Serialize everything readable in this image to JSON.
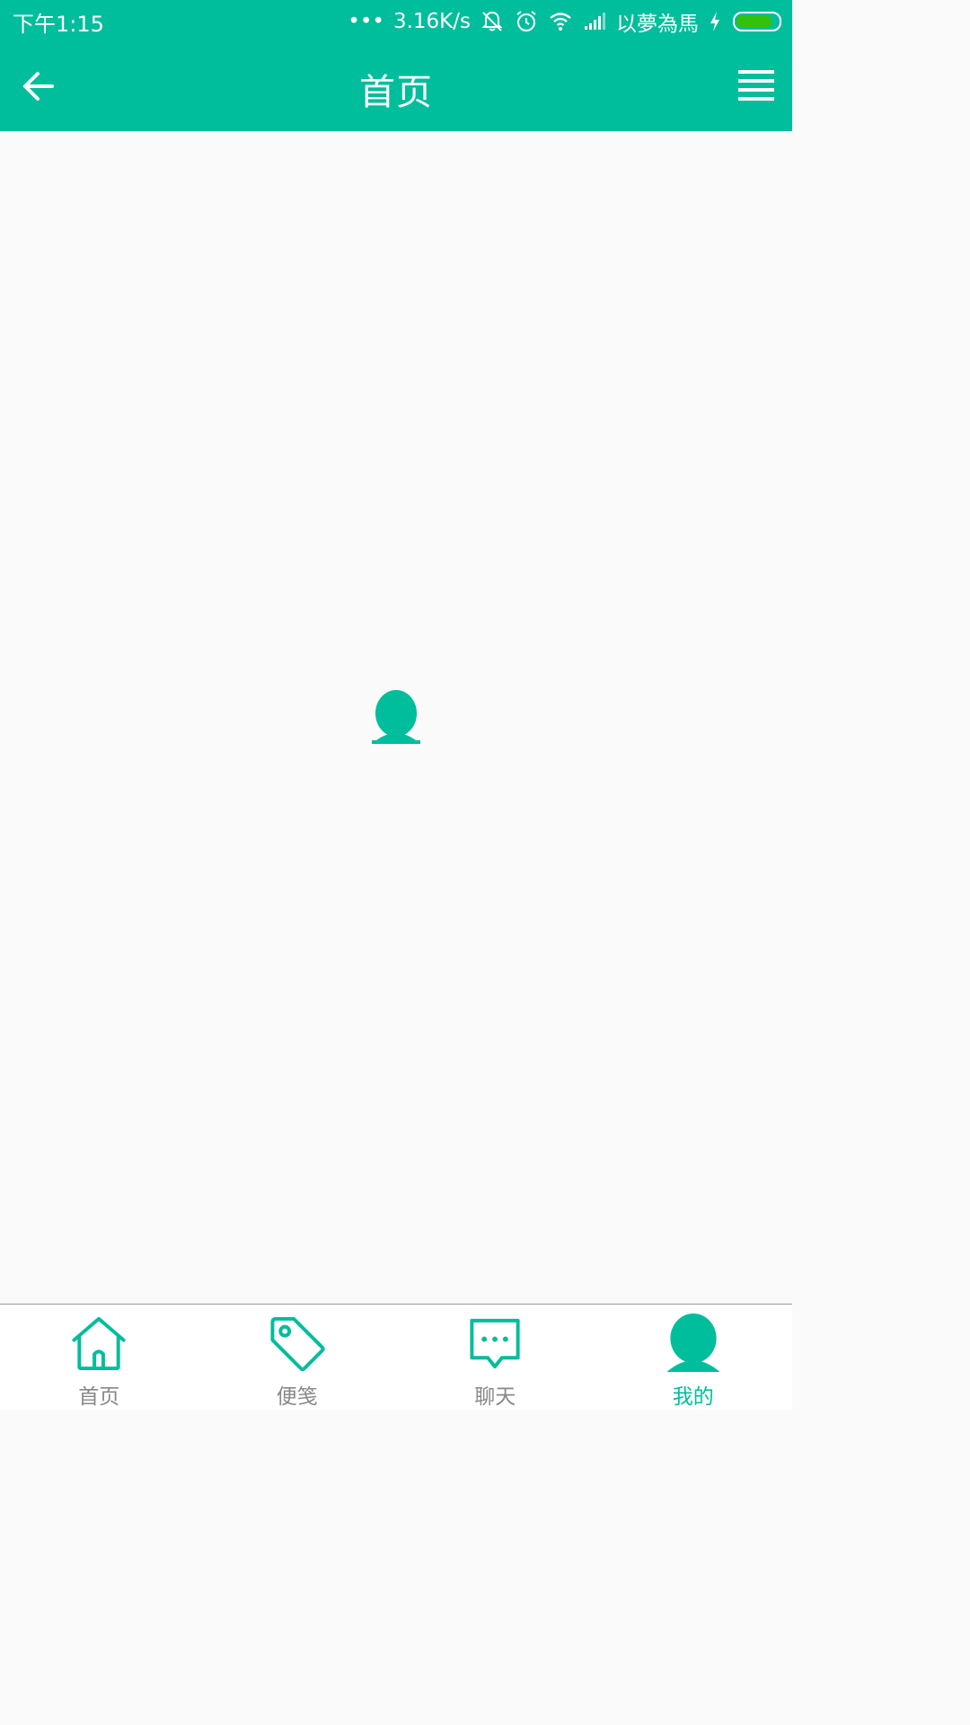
{
  "status_bar": {
    "time": "下午1:15",
    "dots": "•••",
    "net_speed": "3.16K/s",
    "carrier": "以夢為馬",
    "battery_level": 0.85,
    "icons": [
      "mute-bell-icon",
      "alarm-icon",
      "wifi-icon",
      "signal-icon",
      "charging-icon",
      "battery-icon"
    ]
  },
  "header": {
    "title": "首页",
    "back_icon": "arrow-left-icon",
    "menu_icon": "menu-lines-icon"
  },
  "main": {
    "center_icon": "user-avatar-icon"
  },
  "tabbar": {
    "items": [
      {
        "label": "首页",
        "icon": "home-icon",
        "active": false
      },
      {
        "label": "便笺",
        "icon": "tag-icon",
        "active": false
      },
      {
        "label": "聊天",
        "icon": "chat-bubble-icon",
        "active": false
      },
      {
        "label": "我的",
        "icon": "user-icon",
        "active": true
      }
    ]
  },
  "colors": {
    "accent": "#00bd9c",
    "background": "#fafafa",
    "tab_inactive_text": "#888888",
    "battery_fill": "#34c10b"
  }
}
